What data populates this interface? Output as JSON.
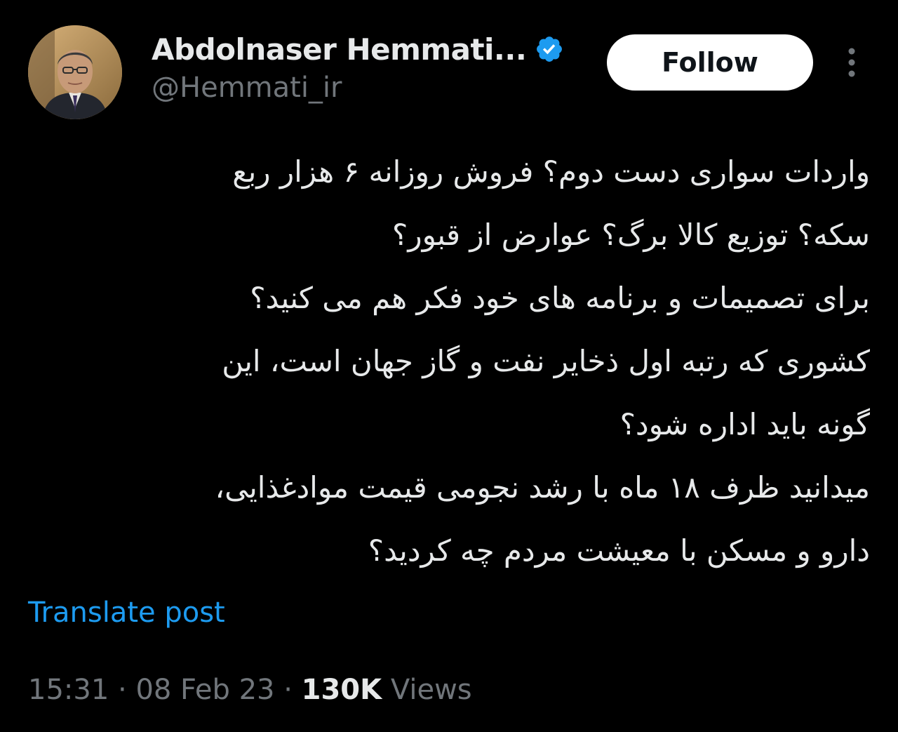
{
  "author": {
    "display_name": "Abdolnaser Hemmati...",
    "handle": "@Hemmati_ir",
    "verified_icon": "verified-badge-icon",
    "avatar_icon": "profile-photo"
  },
  "actions": {
    "follow_label": "Follow",
    "more_icon": "more-vertical-icon"
  },
  "tweet": {
    "lines": [
      "واردات سواری دست دوم؟ فروش روزانه ۶ هزار ربع",
      "سکه؟ توزیع کالا برگ؟ عوارض از قبور؟",
      "برای تصمیمات و برنامه های خود فکر هم می کنید؟",
      "کشوری که رتبه اول ذخایر نفت و گاز جهان است، این",
      "گونه باید اداره شود؟",
      "میدانید ظرف ۱۸ ماه با رشد نجومی قیمت موادغذایی،",
      "دارو و مسکن با معیشت مردم چه کردید؟"
    ],
    "translate_label": "Translate post"
  },
  "meta": {
    "time": "15:31",
    "separator": " · ",
    "date": "08 Feb 23",
    "views_count": "130K",
    "views_label": " Views"
  },
  "colors": {
    "background": "#000000",
    "text": "#e7e9ea",
    "secondary": "#71767b",
    "link": "#1d9bf0",
    "verified": "#1d9bf0"
  }
}
